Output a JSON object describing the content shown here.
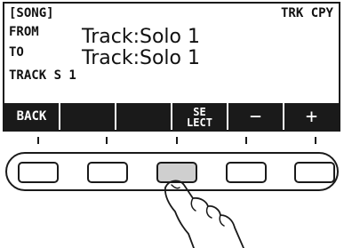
{
  "display": {
    "header_left": "[SONG]",
    "header_right": "TRK CPY",
    "from_label": "FROM",
    "from_value": "Track:Solo 1",
    "to_label": "TO",
    "to_value": "Track:Solo 1",
    "status": "TRACK S 1"
  },
  "softkeys": {
    "back": "BACK",
    "blank": "",
    "select_line1": "SE",
    "select_line2": "LECT",
    "minus": "−",
    "plus": "+"
  },
  "hardware": {
    "pressed_button_index": 2
  }
}
